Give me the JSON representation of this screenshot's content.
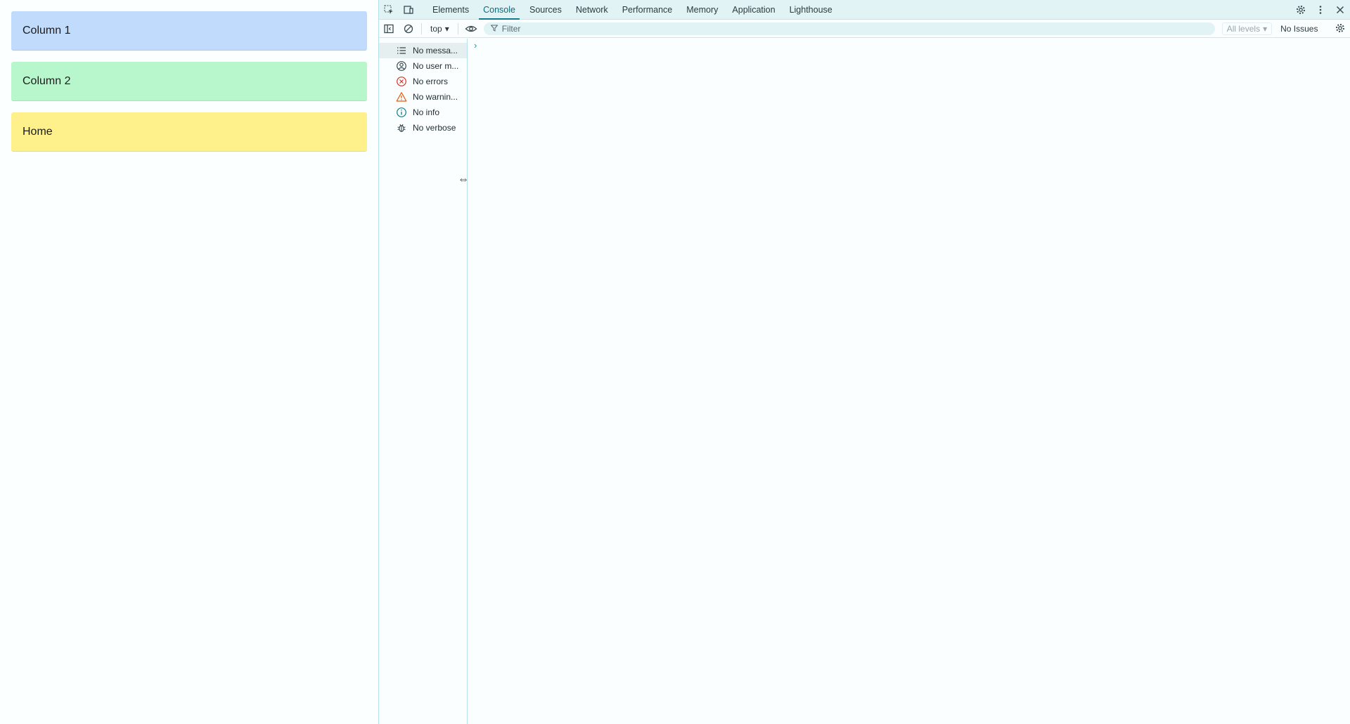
{
  "page": {
    "blocks": [
      {
        "label": "Column 1",
        "color": "#c0dbfb"
      },
      {
        "label": "Column 2",
        "color": "#b8f7cc"
      },
      {
        "label": "Home",
        "color": "#fef08a"
      }
    ]
  },
  "devtools": {
    "tabs": [
      {
        "label": "Elements",
        "active": false
      },
      {
        "label": "Console",
        "active": true
      },
      {
        "label": "Sources",
        "active": false
      },
      {
        "label": "Network",
        "active": false
      },
      {
        "label": "Performance",
        "active": false
      },
      {
        "label": "Memory",
        "active": false
      },
      {
        "label": "Application",
        "active": false
      },
      {
        "label": "Lighthouse",
        "active": false
      }
    ],
    "toolbar": {
      "context": "top",
      "filter_placeholder": "Filter",
      "levels": "All levels",
      "issues": "No Issues"
    },
    "sidebar": [
      {
        "label": "No messa...",
        "icon": "list-icon"
      },
      {
        "label": "No user m...",
        "icon": "user-icon"
      },
      {
        "label": "No errors",
        "icon": "error-icon"
      },
      {
        "label": "No warnin...",
        "icon": "warning-icon"
      },
      {
        "label": "No info",
        "icon": "info-icon"
      },
      {
        "label": "No verbose",
        "icon": "bug-icon"
      }
    ],
    "prompt": "›",
    "accent": "#0f7c8d"
  }
}
